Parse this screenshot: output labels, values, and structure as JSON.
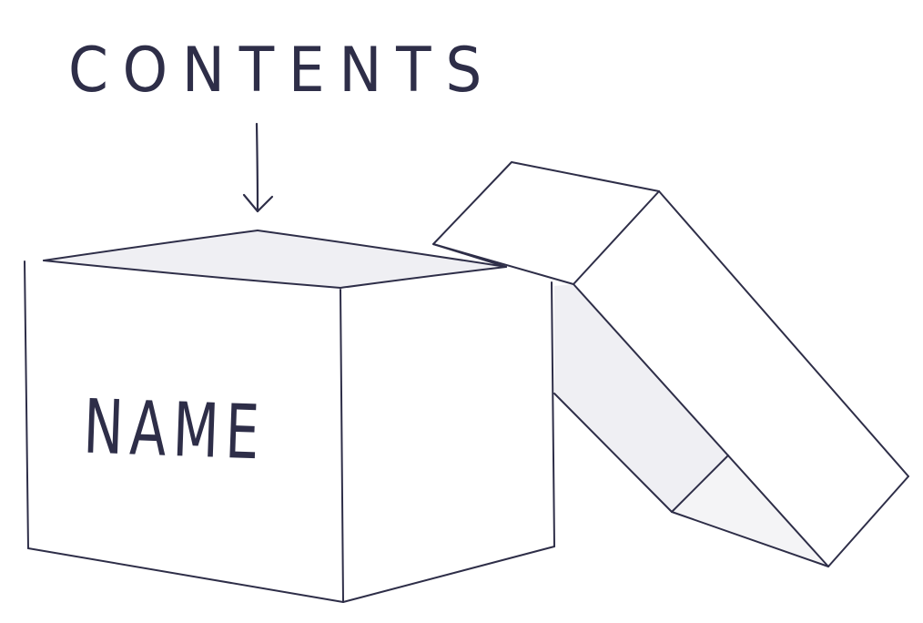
{
  "labels": {
    "contents": "CONTENTS",
    "name": "NAME"
  },
  "colors": {
    "ink": "#2e2e48",
    "paper": "#ffffff",
    "shade": "#efeff3",
    "shade_light": "#f4f4f6"
  }
}
